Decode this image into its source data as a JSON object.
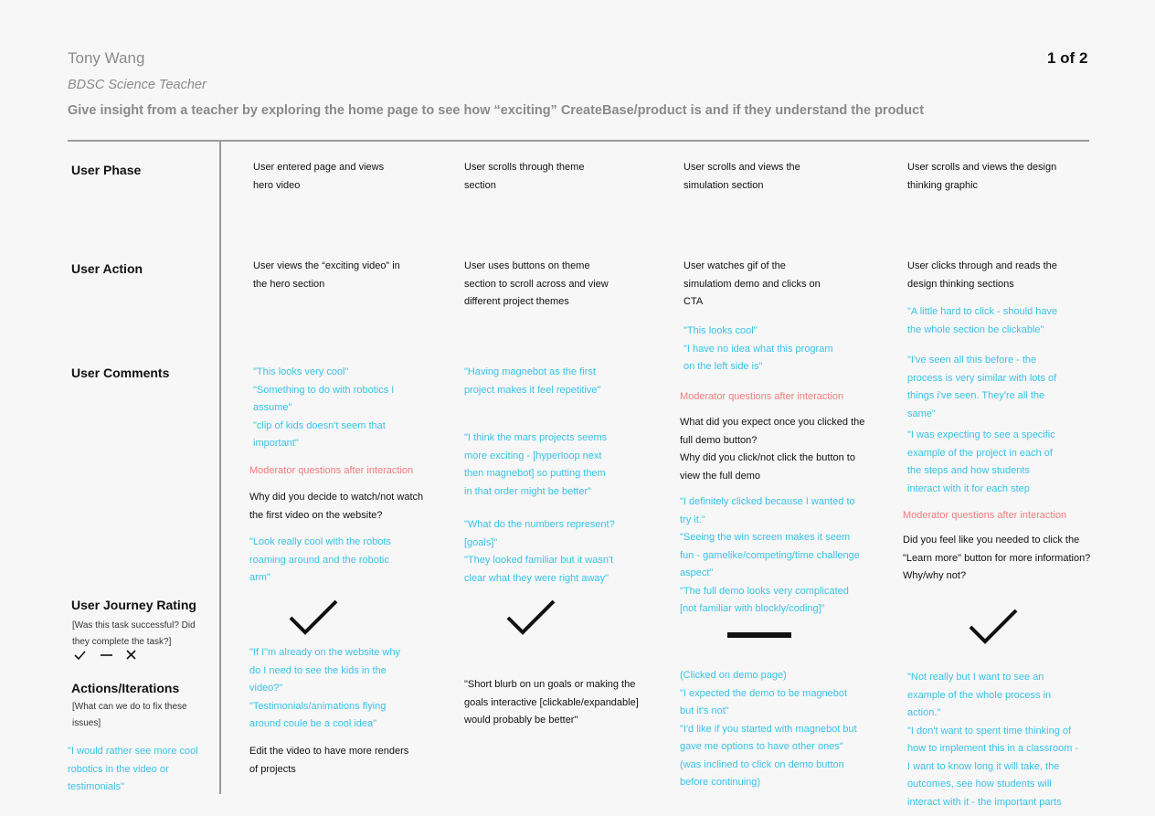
{
  "header": {
    "name": "Tony Wang",
    "role": "BDSC Science Teacher",
    "goal": "Give insight from a teacher by exploring the home page to see how “exciting” CreateBase/product is and if they understand the product",
    "page": "1 of 2"
  },
  "rows": {
    "phase": "User Phase",
    "action": "User Action",
    "comments": "User Comments",
    "rating": "User Journey Rating",
    "rating_sub": [
      "[Was this task successful? Did",
      "they complete the task?]"
    ],
    "iterations": "Actions/Iterations",
    "iterations_sub": [
      "[What can we do to fix these",
      "issues]"
    ],
    "iterations_quote": [
      "\"I would rather see more cool",
      "robotics in the video or",
      "testimonials\""
    ]
  },
  "rating_legend": [
    "success",
    "neutral",
    "fail"
  ],
  "columns": [
    {
      "phase": [
        "User entered page and views",
        "hero video"
      ],
      "action": [
        "User views the “exciting video” in",
        "the hero section"
      ],
      "quotes_a": [
        "\"This looks very cool\"",
        "\"Something to do with robotics I",
        "assume\"",
        "\"clip of kids doesn't seem that",
        "important\""
      ],
      "moderator": "Moderator questions after interaction",
      "question": [
        "Why did you decide to watch/not watch",
        "the first video on the website?"
      ],
      "quotes_b": [
        "\"Look really cool with the robots",
        "roaming around and the robotic",
        "arm\""
      ],
      "rating": "success",
      "iter_quotes": [
        "\"If I\"m already on the website why",
        "do I need to see the kids in the",
        "video?\"",
        "\"Testimonials/animations flying",
        "around coule be a cool idea\""
      ],
      "iter_text": [
        "Edit the video to have more renders",
        "of projects"
      ]
    },
    {
      "phase": [
        "User scrolls through theme",
        "section"
      ],
      "action": [
        "User uses buttons on theme",
        "section to scroll across and view",
        "different project themes"
      ],
      "quotes_a": [
        "\"Having magnebot as the first",
        "project makes it feel repetitive\""
      ],
      "quotes_b": [
        "\"I think the mars projects seems",
        "more exciting - [hyperloop next",
        "then magnebot] so putting them",
        "in that order might be better\""
      ],
      "quotes_c": [
        "\"What do the numbers represent?",
        "[goals]\"",
        "\"They looked familiar but it wasn't",
        "clear what they were right away\""
      ],
      "rating": "success",
      "iter_text": [
        "\"Short blurb on un goals or making the",
        "goals interactive [clickable/expandable]",
        "would probably be better\""
      ]
    },
    {
      "phase": [
        "User scrolls and views the",
        "simulation section"
      ],
      "action": [
        "User watches gif of the",
        "simulatiom demo and clicks on",
        "CTA"
      ],
      "quotes_a": [
        "\"This looks cool\"",
        "\"I have no idea what this program",
        "on the left side is\""
      ],
      "moderator": "Moderator questions after interaction",
      "question": [
        "What did you expect once you clicked the",
        "full demo button?",
        "Why did you click/not click the button to",
        "view the full demo"
      ],
      "quotes_b": [
        "\"I definitely clicked because I wanted to",
        "try it.\"",
        "\"Seeing the win screen makes it seem",
        "fun - gamelike/competing/time challenge",
        "aspect\"",
        "\"The full demo looks very complicated",
        "[not familiar with blockly/coding]\""
      ],
      "rating": "neutral",
      "iter_quotes": [
        "(Clicked on demo page)",
        "\"I expected the demo to be magnebot",
        "but it's not\"",
        "\"I'd like if you started with magnebot but",
        "gave me options to have other ones\"",
        "(was inclined to click on demo button",
        "before continuing)"
      ]
    },
    {
      "phase": [
        "User scrolls and views the design",
        "thinking graphic"
      ],
      "action": [
        "User clicks through and reads the",
        "design thinking sections"
      ],
      "quotes_a": [
        "\"A little hard to click - should have",
        "the whole section be clickable\""
      ],
      "quotes_b": [
        "\"I've seen all this before - the",
        "process is very similar with lots of",
        "things i've seen. They're all the",
        "same\""
      ],
      "quotes_c": [
        "\"I was expecting to see a specific",
        "example of the project in each of",
        "the steps and how students",
        "interact with it for each step"
      ],
      "moderator": "Moderator questions after interaction",
      "question": [
        "Did you feel like you needed to click the",
        "\"Learn more\" button for more information?",
        "Why/why not?"
      ],
      "rating": "success",
      "iter_quotes": [
        "\"Not really but I want to see an",
        "example of the whole process in",
        "action.\"",
        "\"I don't want to spent time thinking of",
        "how to implement this in a classroom -",
        "I want to know long it will take, the",
        "outcomes, see how students will",
        "interact with it - the important parts"
      ]
    }
  ]
}
